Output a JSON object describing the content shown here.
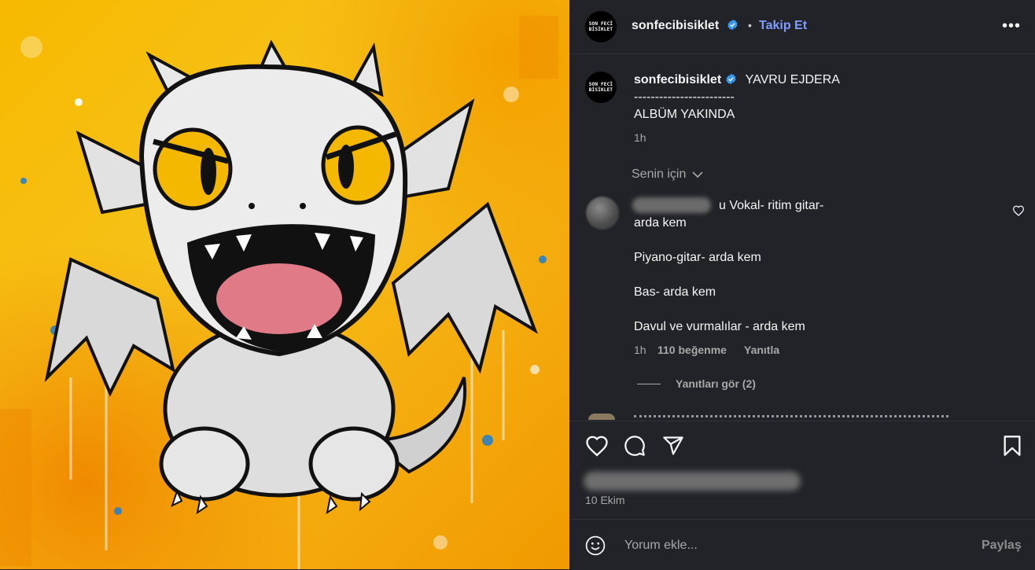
{
  "account": {
    "username": "sonfecibisiklet",
    "avatar_text": [
      "SON FECİ",
      "BİSİKLET"
    ],
    "verified": true
  },
  "header": {
    "dot": "•",
    "follow_label": "Takip Et",
    "more_label": "•••"
  },
  "caption": {
    "text": "YAVRU EJDERA",
    "separator": "------------------------",
    "line2": "ALBÜM YAKINDA",
    "time": "1h"
  },
  "comments_filter": {
    "label": "Senin için"
  },
  "comment": {
    "lines": [
      "u Vokal- ritim gitar-",
      "arda kem",
      "Piyano-gitar- arda kem",
      "Bas- arda kem",
      "Davul ve vurmalılar - arda kem"
    ],
    "time": "1h",
    "likes": "110 beğenme",
    "reply": "Yanıtla",
    "view_replies": "Yanıtları gör (2)"
  },
  "actions": {
    "date": "10 Ekim"
  },
  "composer": {
    "placeholder": "Yorum ekle...",
    "share_label": "Paylaş"
  },
  "colors": {
    "background": "#212328",
    "follow": "#7f9dff",
    "verified": "#3897f0",
    "muted_text": "#a8a8a8",
    "image_yellow": "#f6c21a"
  },
  "icons": [
    "verified-badge-icon",
    "more-icon",
    "chevron-down-icon",
    "heart-icon",
    "comment-icon",
    "share-icon",
    "bookmark-icon",
    "emoji-icon"
  ]
}
